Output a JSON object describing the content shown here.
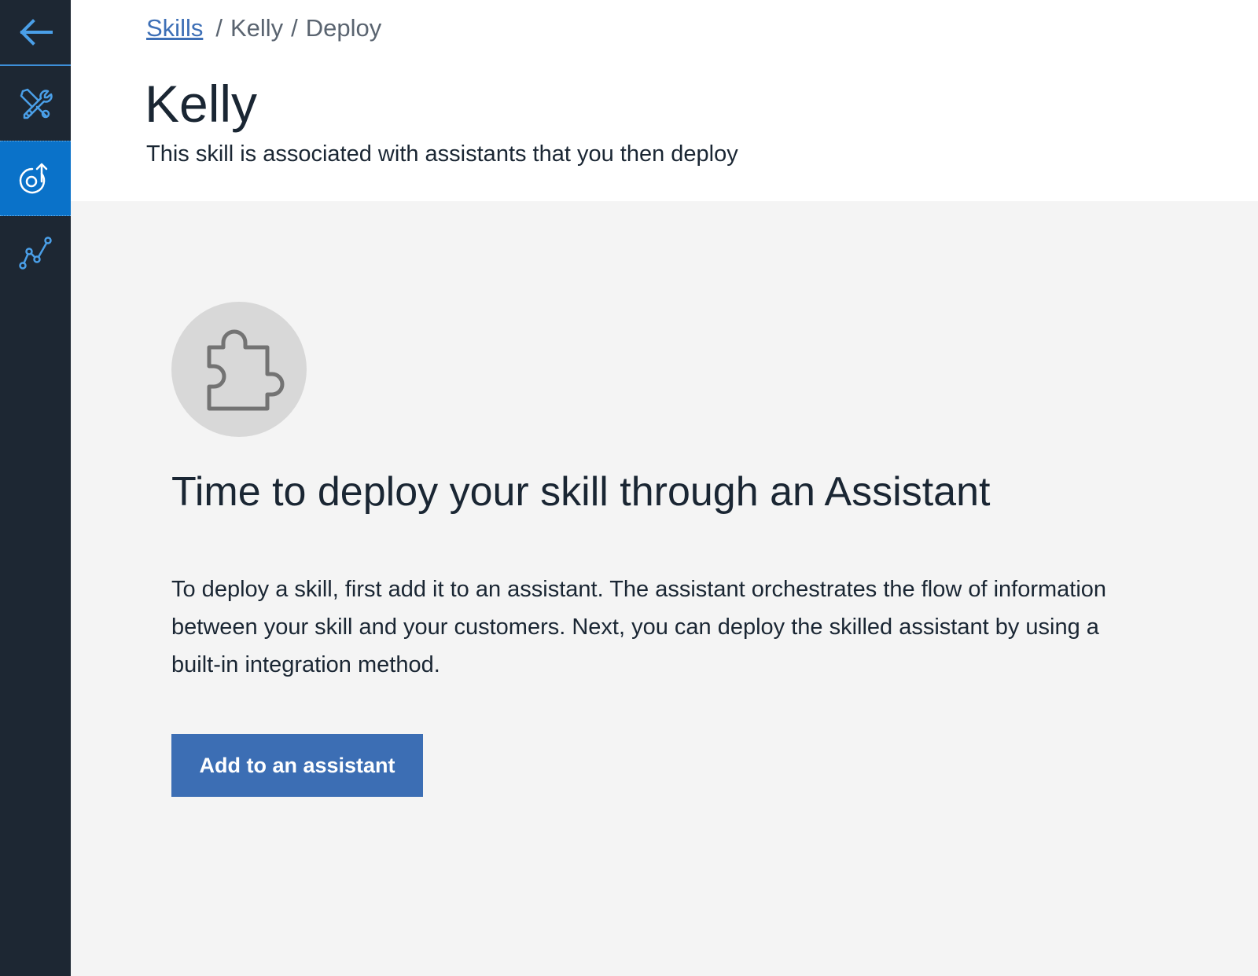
{
  "sidenav": {
    "items": [
      {
        "name": "back",
        "icon": "arrow-left-icon"
      },
      {
        "name": "build",
        "icon": "tools-icon"
      },
      {
        "name": "deploy",
        "icon": "deploy-icon",
        "active": true
      },
      {
        "name": "improve",
        "icon": "analytics-icon"
      }
    ],
    "colors": {
      "background": "#1d2733",
      "active": "#0a72c9",
      "icon": "#4a9fe8"
    }
  },
  "breadcrumb": {
    "link": "Skills",
    "separator": "/",
    "item2": "Kelly",
    "item3": "Deploy"
  },
  "header": {
    "title": "Kelly",
    "subtitle": "This skill is associated with assistants that you then deploy"
  },
  "empty_state": {
    "icon": "puzzle-piece-icon",
    "title": "Time to deploy your skill through an Assistant",
    "body": "To deploy a skill, first add it to an assistant. The assistant orchestrates the flow of information between your skill and your customers. Next, you can deploy the skilled assistant by using a built-in integration method.",
    "button_label": "Add to an assistant"
  },
  "colors": {
    "primary_button": "#3c6eb4",
    "link": "#3d6fb6",
    "content_background": "#f4f4f4"
  }
}
